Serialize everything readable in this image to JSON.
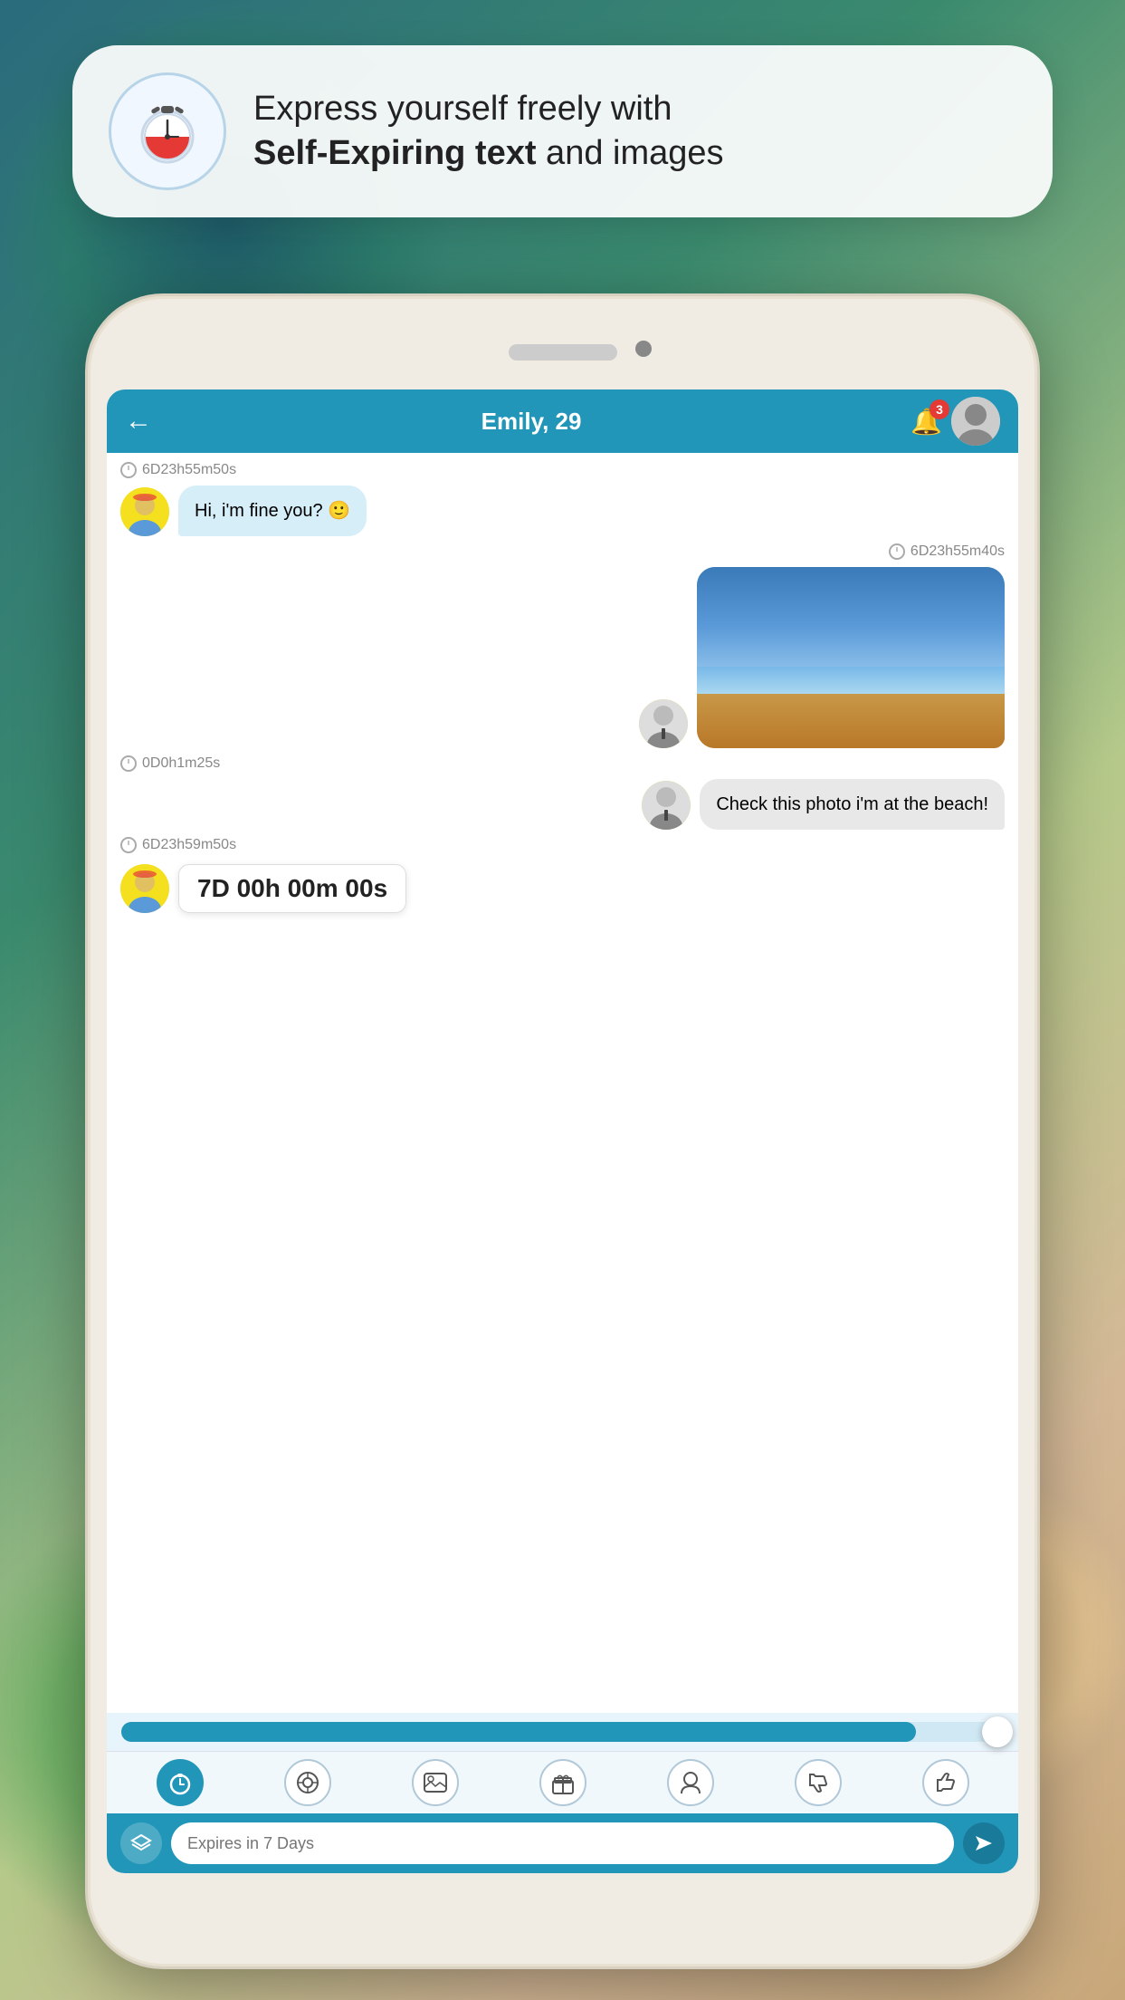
{
  "background": {
    "colors": [
      "#2a6b7c",
      "#3a8a6e",
      "#b5c98a",
      "#d4b896"
    ]
  },
  "feature_card": {
    "text_line1": "Express yourself freely with",
    "text_line2": "Self-Expiring text",
    "text_line3": " and images"
  },
  "chat": {
    "header": {
      "title": "Emily, 29",
      "back_label": "←",
      "notification_count": "3"
    },
    "messages": [
      {
        "id": "msg1",
        "timer": "6D23h55m50s",
        "timer_side": "left",
        "type": "text",
        "side": "left",
        "text": "Hi, i'm fine you? 🙂",
        "has_avatar": true
      },
      {
        "id": "msg2",
        "timer": "6D23h55m40s",
        "timer_side": "right",
        "type": "image",
        "side": "right",
        "has_avatar": true
      },
      {
        "id": "msg3",
        "timer": "0D0h1m25s",
        "timer_side": "left",
        "type": "text",
        "side": "right",
        "text": "Check this photo i'm at the beach!",
        "has_avatar": true
      },
      {
        "id": "msg4",
        "timer": "6D23h59m50s",
        "timer_side": "left",
        "type": "timer_display",
        "side": "left",
        "timer_value": "7D 00h 00m 00s",
        "has_avatar": true
      }
    ],
    "toolbar": {
      "buttons": [
        "⏱",
        "◎",
        "🖼",
        "🎁",
        "👤",
        "👎",
        "👍"
      ]
    },
    "input": {
      "placeholder": "Expires in 7 Days",
      "layers_label": "≡",
      "send_label": "▶"
    }
  }
}
